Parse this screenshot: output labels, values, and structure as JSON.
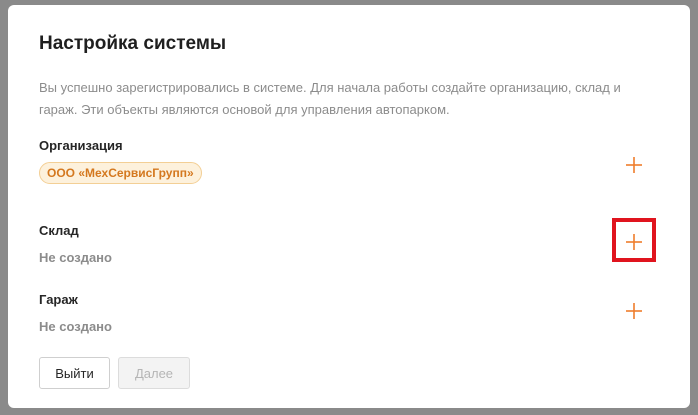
{
  "dialog": {
    "title": "Настройка системы",
    "description": "Вы успешно зарегистрировались в системе. Для начала работы создайте организацию, склад и гараж. Эти объекты являются основой для управления автопарком."
  },
  "sections": {
    "organization": {
      "label": "Организация",
      "value": "ООО «МехСервисГрупп»",
      "add_icon": "plus-icon"
    },
    "warehouse": {
      "label": "Склад",
      "status": "Не создано",
      "add_icon": "plus-icon"
    },
    "garage": {
      "label": "Гараж",
      "status": "Не создано",
      "add_icon": "plus-icon"
    }
  },
  "buttons": {
    "exit_label": "Выйти",
    "next_label": "Далее",
    "next_disabled": true
  },
  "colors": {
    "accent": "#ee7d2c",
    "tag_bg": "#fdf1dc",
    "tag_border": "#f3cf95",
    "tag_text": "#d4781f",
    "highlight": "#e0141e"
  }
}
